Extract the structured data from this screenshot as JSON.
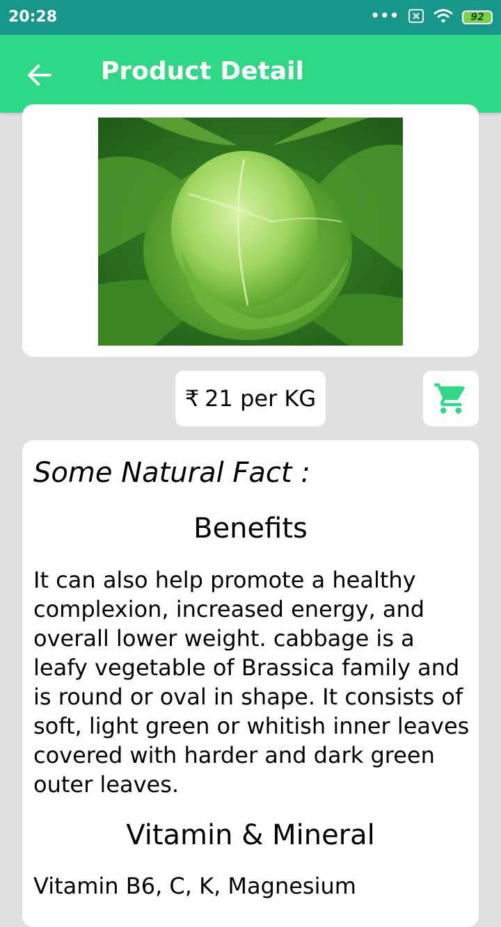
{
  "status_bar": {
    "time": "20:28",
    "dots": "•••",
    "battery": "92"
  },
  "app_bar": {
    "title": "Product Detail"
  },
  "product": {
    "price_symbol": "₹",
    "price_text": "21 per KG"
  },
  "info": {
    "fact_heading": "Some Natural Fact :",
    "benefits_title": "Benefits",
    "benefits_text": "It can also help promote a healthy complexion, increased energy, and overall lower weight. cabbage is a leafy vegetable of Brassica family and is round or oval in shape. It consists of soft, light green or whitish inner leaves covered with harder and dark green outer leaves.",
    "vitamin_title": "Vitamin & Mineral",
    "vitamin_text": "Vitamin B6, C, K, Magnesium"
  },
  "colors": {
    "status_bar": "#17978a",
    "app_bar": "#2ed884",
    "accent": "#2ed884",
    "background": "#e0e0e0"
  },
  "icons": [
    "back-arrow-icon",
    "cart-icon",
    "wifi-icon",
    "sim-icon",
    "battery-icon"
  ]
}
